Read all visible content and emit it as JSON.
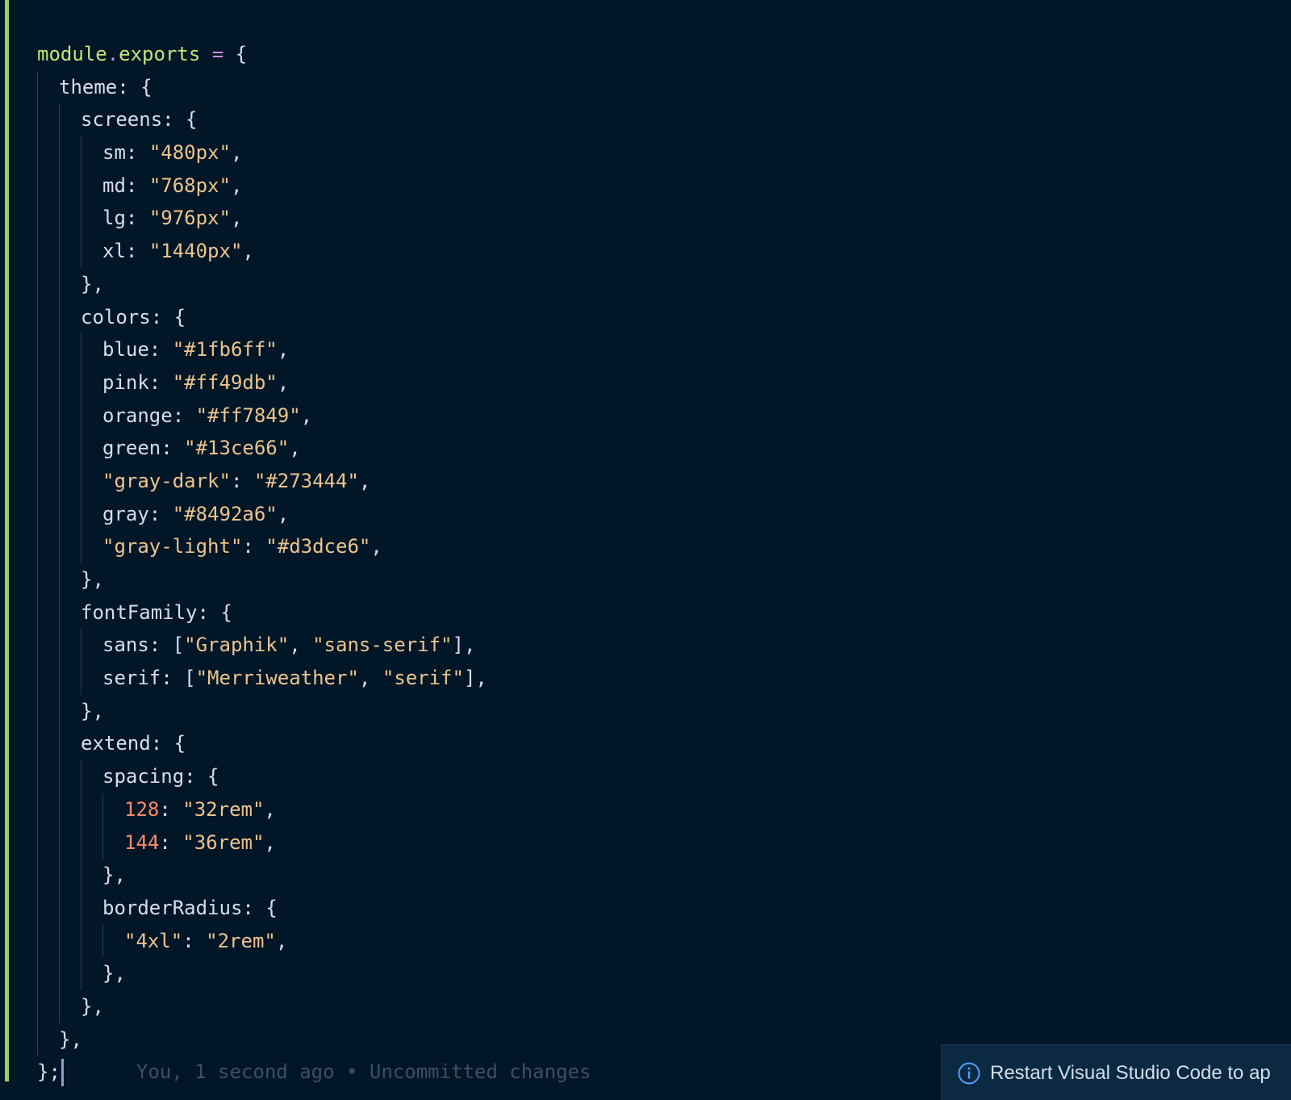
{
  "colors": {
    "background": "#011627",
    "git_bar": "#9ccc65",
    "string": "#ecc48d",
    "number": "#f78c6c",
    "object": "#c5e478",
    "operator": "#c792ea",
    "text": "#d6deeb",
    "info_icon": "#4fa3ff"
  },
  "code": {
    "l1": {
      "obj": "module",
      "dot": ".",
      "prop": "exports",
      "op": " = ",
      "brace": "{"
    },
    "l2": {
      "key": "theme",
      "rest": ": {"
    },
    "l3": {
      "key": "screens",
      "rest": ": {"
    },
    "l4": {
      "key": "sm",
      "sep": ": ",
      "val": "\"480px\"",
      "tail": ","
    },
    "l5": {
      "key": "md",
      "sep": ": ",
      "val": "\"768px\"",
      "tail": ","
    },
    "l6": {
      "key": "lg",
      "sep": ": ",
      "val": "\"976px\"",
      "tail": ","
    },
    "l7": {
      "key": "xl",
      "sep": ": ",
      "val": "\"1440px\"",
      "tail": ","
    },
    "l8": {
      "text": "},"
    },
    "l9": {
      "key": "colors",
      "rest": ": {"
    },
    "l10": {
      "key": "blue",
      "sep": ": ",
      "val": "\"#1fb6ff\"",
      "tail": ","
    },
    "l11": {
      "key": "pink",
      "sep": ": ",
      "val": "\"#ff49db\"",
      "tail": ","
    },
    "l12": {
      "key": "orange",
      "sep": ": ",
      "val": "\"#ff7849\"",
      "tail": ","
    },
    "l13": {
      "key": "green",
      "sep": ": ",
      "val": "\"#13ce66\"",
      "tail": ","
    },
    "l14": {
      "key": "\"gray-dark\"",
      "sep": ": ",
      "val": "\"#273444\"",
      "tail": ","
    },
    "l15": {
      "key": "gray",
      "sep": ": ",
      "val": "\"#8492a6\"",
      "tail": ","
    },
    "l16": {
      "key": "\"gray-light\"",
      "sep": ": ",
      "val": "\"#d3dce6\"",
      "tail": ","
    },
    "l17": {
      "text": "},"
    },
    "l18": {
      "key": "fontFamily",
      "rest": ": {"
    },
    "l19": {
      "key": "sans",
      "sep": ": [",
      "v1": "\"Graphik\"",
      "mid": ", ",
      "v2": "\"sans-serif\"",
      "tail": "],"
    },
    "l20": {
      "key": "serif",
      "sep": ": [",
      "v1": "\"Merriweather\"",
      "mid": ", ",
      "v2": "\"serif\"",
      "tail": "],"
    },
    "l21": {
      "text": "},"
    },
    "l22": {
      "key": "extend",
      "rest": ": {"
    },
    "l23": {
      "key": "spacing",
      "rest": ": {"
    },
    "l24": {
      "num": "128",
      "sep": ": ",
      "val": "\"32rem\"",
      "tail": ","
    },
    "l25": {
      "num": "144",
      "sep": ": ",
      "val": "\"36rem\"",
      "tail": ","
    },
    "l26": {
      "text": "},"
    },
    "l27": {
      "key": "borderRadius",
      "rest": ": {"
    },
    "l28": {
      "key": "\"4xl\"",
      "sep": ": ",
      "val": "\"2rem\"",
      "tail": ","
    },
    "l29": {
      "text": "},"
    },
    "l30": {
      "text": "},"
    },
    "l31": {
      "text": "},"
    },
    "l32": {
      "text": "};"
    }
  },
  "blame": "You, 1 second ago • Uncommitted changes",
  "notification": {
    "icon": "info-icon",
    "text": "Restart Visual Studio Code to ap"
  }
}
